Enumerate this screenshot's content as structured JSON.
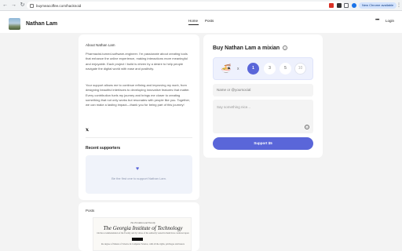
{
  "browser": {
    "url": "buymeacoffee.com/hacknoid",
    "new_chrome_label": "New Chrome available"
  },
  "header": {
    "creator_name": "Nathan Lam",
    "tabs": [
      {
        "label": "Home",
        "active": true
      },
      {
        "label": "Posts",
        "active": false
      }
    ],
    "more_label": "•••",
    "login_label": "Login"
  },
  "about": {
    "title": "About Nathan Lam",
    "paragraph1": "Pharmacist-turned-software-engineer. I’m passionate about creating tools that enhance the online experience, making interactions more meaningful and enjoyable. Each project I build is driven by a desire to help people navigate the digital world with ease and positivity.",
    "paragraph2": "Your support allows me to continue refining and improving my work, from designing beautiful interfaces to developing innovative features that matter. Every contribution fuels my journey and brings me closer to creating something that not only works but resonates with people like you. Together, we can make a lasting impact—thank you for being part of this journey!",
    "social_icon": "x-icon",
    "supporters_title": "Recent supporters",
    "first_one_text": "Be the first one to support Nathan Lam."
  },
  "posts": {
    "title": "Posts",
    "thumbnail": {
      "line1": "The President and Faculty",
      "line2": "The Georgia Institute of Technology",
      "line3": "On the recommendation of the Faculty and by virtue of the authority vested in them have conferred upon",
      "line4": "the degree of Master of Science in Computer Science, with all the rights, privileges and honors"
    }
  },
  "buy": {
    "title": "Buy Nathan Lam a mixian",
    "info_icon": "info-icon",
    "item_icon": "noodle-bowl-icon",
    "times": "x",
    "quantities": [
      "1",
      "3",
      "5",
      "10"
    ],
    "selected_quantity": "1",
    "name_placeholder": "Name or @yoursocial",
    "message_placeholder": "Say something nice...",
    "support_label": "Support $5"
  },
  "colors": {
    "accent": "#5a66d9",
    "qty_box_bg": "#eef1fd",
    "page_bg": "#f3f3f3"
  }
}
